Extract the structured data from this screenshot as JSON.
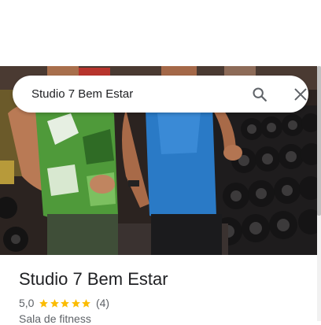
{
  "search": {
    "query": "Studio 7 Bem Estar",
    "search_icon": "search-icon",
    "clear_icon": "close-icon"
  },
  "place": {
    "title": "Studio 7 Bem Estar",
    "rating": "5,0",
    "stars": 5,
    "review_count": "(4)",
    "category": "Sala de fitness",
    "star_color": "#fbbc04"
  },
  "photo": {
    "subject_icon": "gym-photo"
  }
}
